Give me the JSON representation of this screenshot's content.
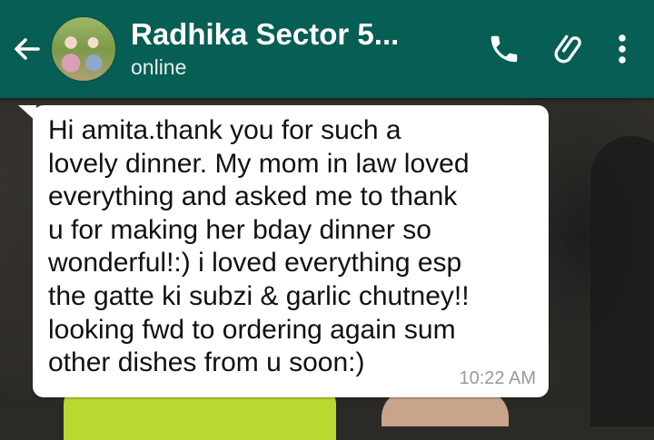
{
  "header": {
    "contact_name": "Radhika Sector 5...",
    "status": "online",
    "icons": {
      "back": "arrow-left-icon",
      "call": "phone-icon",
      "attach": "paperclip-icon",
      "menu": "more-vertical-icon"
    },
    "color": "#075e54"
  },
  "message": {
    "text": "Hi amita.thank you for such a\nlovely dinner. My mom in law loved\neverything and asked me to thank\nu for making her bday dinner so\nwonderful!:) i loved everything esp\nthe gatte ki subzi & garlic chutney!!\nlooking fwd to ordering again sum\nother dishes from u soon:)",
    "time": "10:22 AM"
  }
}
